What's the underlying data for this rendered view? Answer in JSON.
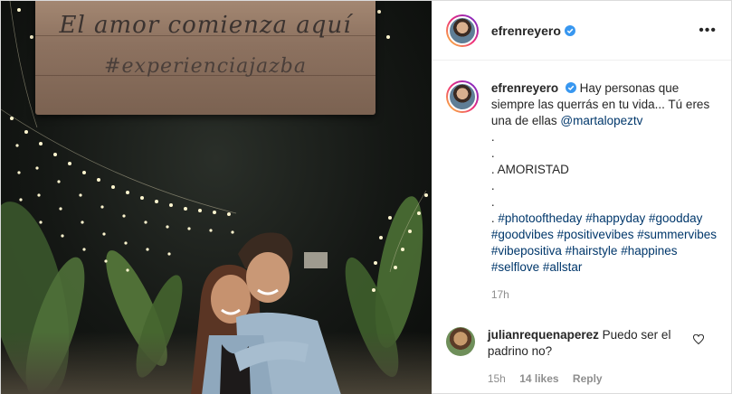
{
  "photo": {
    "sign_line1": "El amor comienza aquí",
    "sign_line2": "#experienciajazba"
  },
  "header": {
    "username": "efrenreyero",
    "more_icon": "more-icon"
  },
  "caption": {
    "username": "efrenreyero",
    "text_1": "Hay personas que siempre las querrás en tu vida... Tú eres una de ellas",
    "mention": "@martalopeztv",
    "dot_1": ".",
    "dot_2": ".",
    "amoristad": ". AMORISTAD",
    "dot_3": ".",
    "dot_4": ".",
    "tags_prefix": ". ",
    "tags": [
      "#photooftheday",
      "#happyday",
      "#goodday",
      "#goodvibes",
      "#positivevibes",
      "#summervibes",
      "#vibepositiva",
      "#hairstyle",
      "#happines",
      "#selflove",
      "#allstar"
    ],
    "time": "17h"
  },
  "comment": {
    "username": "julianrequenaperez",
    "text": "Puedo ser el padrino no?",
    "time": "15h",
    "likes": "14 likes",
    "reply": "Reply"
  },
  "colors": {
    "verified": "#3897f0",
    "link": "#00376b",
    "muted": "#8e8e8e"
  }
}
